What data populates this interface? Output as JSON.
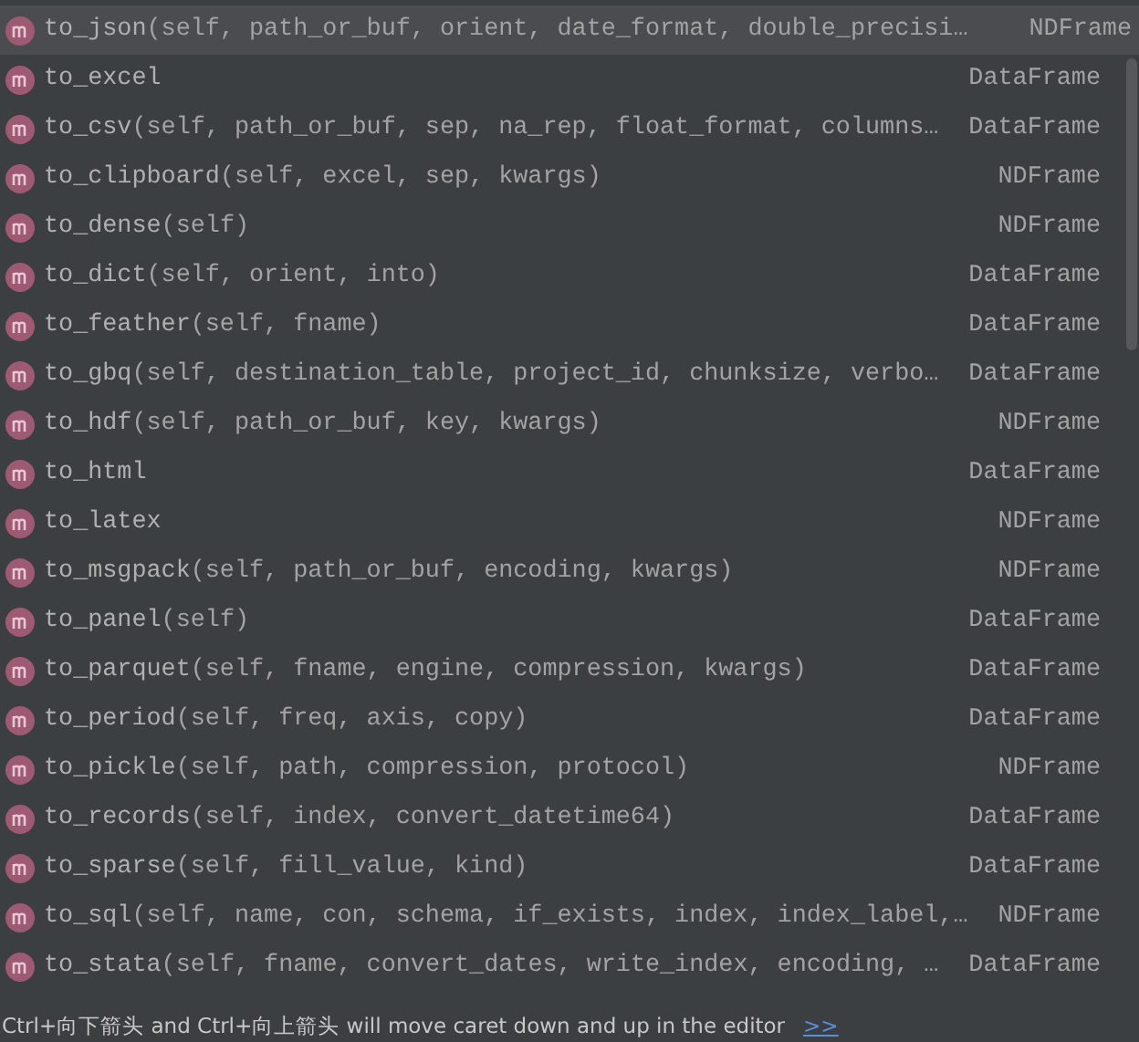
{
  "completion_list": [
    {
      "name": "to_json",
      "signature": "(self, path_or_buf, orient, date_format, double_precisi…",
      "type": "NDFrame",
      "selected": true
    },
    {
      "name": "to_excel",
      "type": "DataFrame",
      "selected": false
    },
    {
      "name": "to_csv",
      "signature": "(self, path_or_buf, sep, na_rep, float_format, columns…",
      "type": "DataFrame",
      "selected": false
    },
    {
      "name": "to_clipboard",
      "signature": "(self, excel, sep, kwargs)",
      "type": "NDFrame",
      "selected": false
    },
    {
      "name": "to_dense",
      "signature": "(self)",
      "type": "NDFrame",
      "selected": false
    },
    {
      "name": "to_dict",
      "signature": "(self, orient, into)",
      "type": "DataFrame",
      "selected": false
    },
    {
      "name": "to_feather",
      "signature": "(self, fname)",
      "type": "DataFrame",
      "selected": false
    },
    {
      "name": "to_gbq",
      "signature": "(self, destination_table, project_id, chunksize, verbo…",
      "type": "DataFrame",
      "selected": false
    },
    {
      "name": "to_hdf",
      "signature": "(self, path_or_buf, key, kwargs)",
      "type": "NDFrame",
      "selected": false
    },
    {
      "name": "to_html",
      "type": "DataFrame",
      "selected": false
    },
    {
      "name": "to_latex",
      "type": "NDFrame",
      "selected": false
    },
    {
      "name": "to_msgpack",
      "signature": "(self, path_or_buf, encoding, kwargs)",
      "type": "NDFrame",
      "selected": false
    },
    {
      "name": "to_panel",
      "signature": "(self)",
      "type": "DataFrame",
      "selected": false
    },
    {
      "name": "to_parquet",
      "signature": "(self, fname, engine, compression, kwargs)",
      "type": "DataFrame",
      "selected": false
    },
    {
      "name": "to_period",
      "signature": "(self, freq, axis, copy)",
      "type": "DataFrame",
      "selected": false
    },
    {
      "name": "to_pickle",
      "signature": "(self, path, compression, protocol)",
      "type": "NDFrame",
      "selected": false
    },
    {
      "name": "to_records",
      "signature": "(self, index, convert_datetime64)",
      "type": "DataFrame",
      "selected": false
    },
    {
      "name": "to_sparse",
      "signature": "(self, fill_value, kind)",
      "type": "DataFrame",
      "selected": false
    },
    {
      "name": "to_sql",
      "signature": "(self, name, con, schema, if_exists, index, index_label,…",
      "type": "NDFrame",
      "selected": false
    },
    {
      "name": "to_stata",
      "signature": "(self, fname, convert_dates, write_index, encoding, …",
      "type": "DataFrame",
      "selected": false
    }
  ],
  "status_bar": {
    "hint": "Ctrl+向下箭头 and Ctrl+向上箭头 will move caret down and up in the editor",
    "link": ">>"
  }
}
